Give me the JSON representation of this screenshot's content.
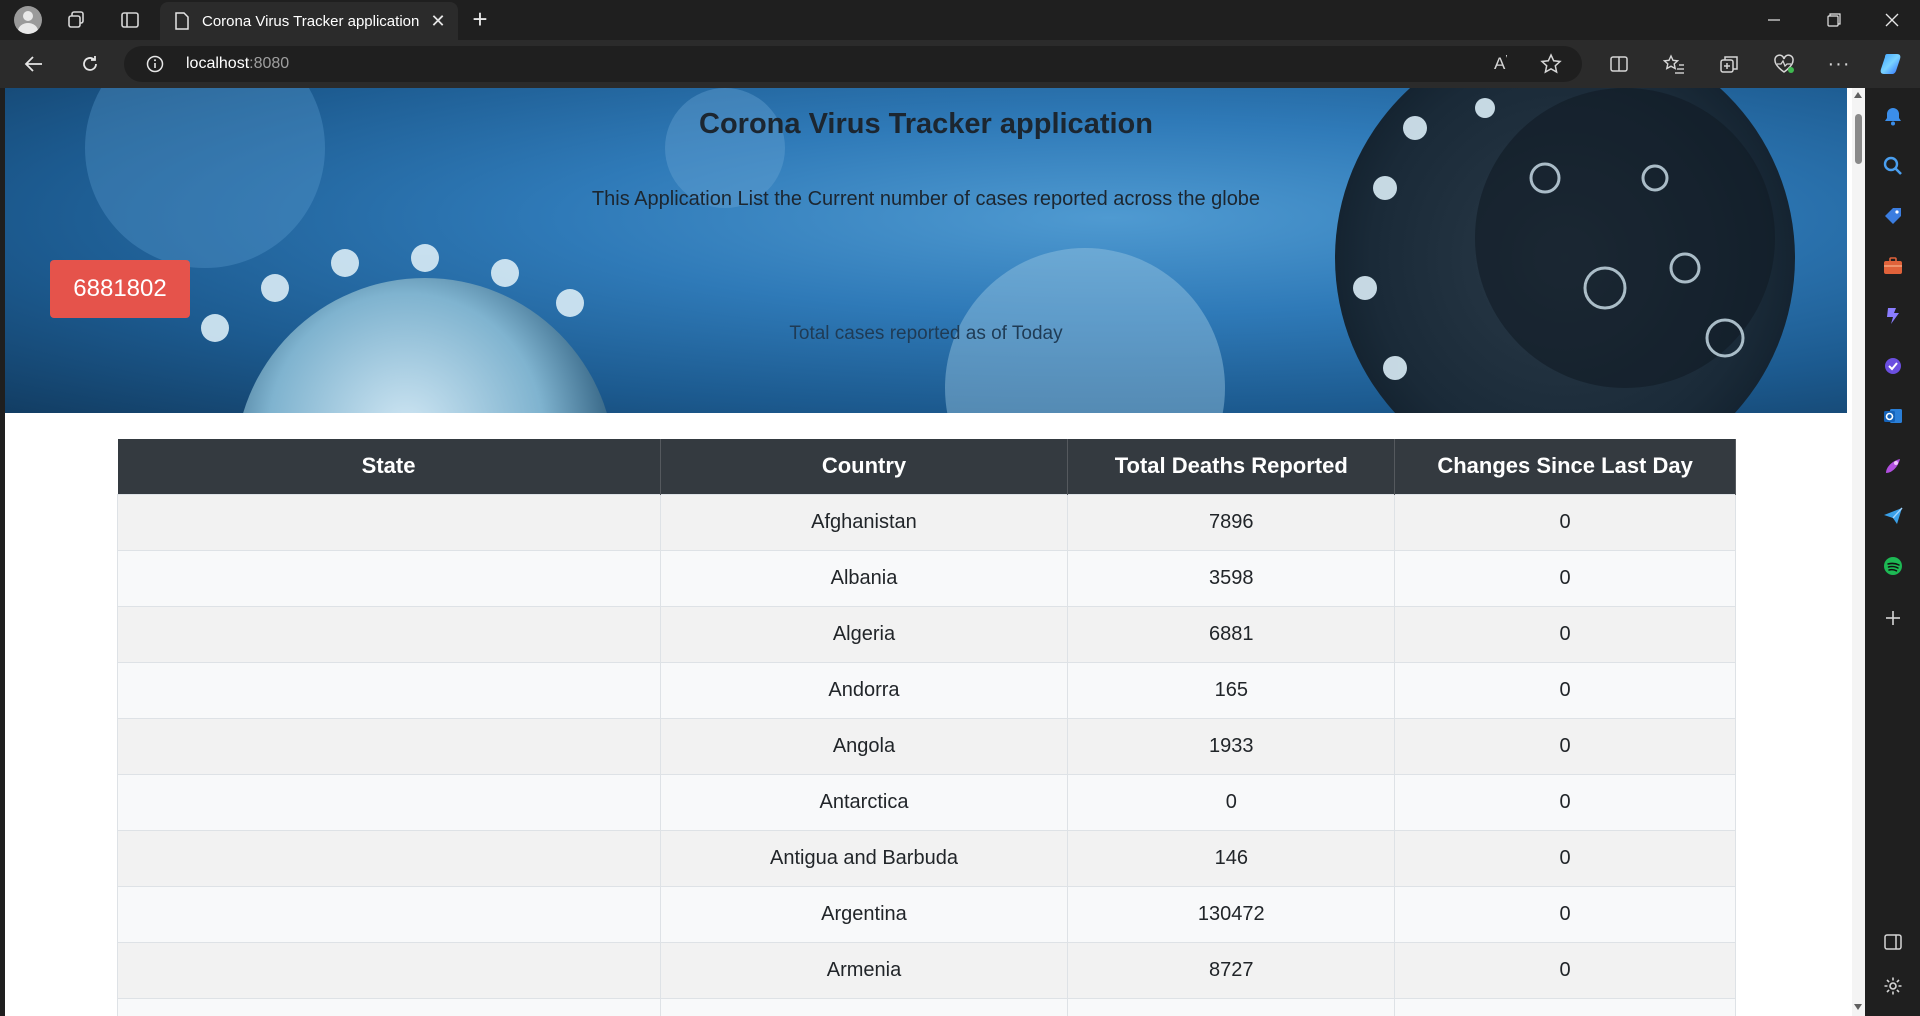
{
  "browser": {
    "tab_title": "Corona Virus Tracker application",
    "url_host": "localhost",
    "url_port": ":8080",
    "new_tab_label": "+"
  },
  "hero": {
    "title": "Corona Virus Tracker application",
    "subtitle": "This Application List the Current number of cases reported across the globe",
    "total_cases": "6881802",
    "total_label": "Total cases reported as of Today"
  },
  "table": {
    "headers": [
      "State",
      "Country",
      "Total Deaths Reported",
      "Changes Since Last Day"
    ],
    "rows": [
      {
        "state": "",
        "country": "Afghanistan",
        "deaths": "7896",
        "change": "0"
      },
      {
        "state": "",
        "country": "Albania",
        "deaths": "3598",
        "change": "0"
      },
      {
        "state": "",
        "country": "Algeria",
        "deaths": "6881",
        "change": "0"
      },
      {
        "state": "",
        "country": "Andorra",
        "deaths": "165",
        "change": "0"
      },
      {
        "state": "",
        "country": "Angola",
        "deaths": "1933",
        "change": "0"
      },
      {
        "state": "",
        "country": "Antarctica",
        "deaths": "0",
        "change": "0"
      },
      {
        "state": "",
        "country": "Antigua and Barbuda",
        "deaths": "146",
        "change": "0"
      },
      {
        "state": "",
        "country": "Argentina",
        "deaths": "130472",
        "change": "0"
      },
      {
        "state": "",
        "country": "Armenia",
        "deaths": "8727",
        "change": "0"
      },
      {
        "state": "",
        "country": "",
        "deaths": "",
        "change": ""
      }
    ]
  },
  "colors": {
    "badge": "#e5534b",
    "table_header": "#343a40"
  }
}
